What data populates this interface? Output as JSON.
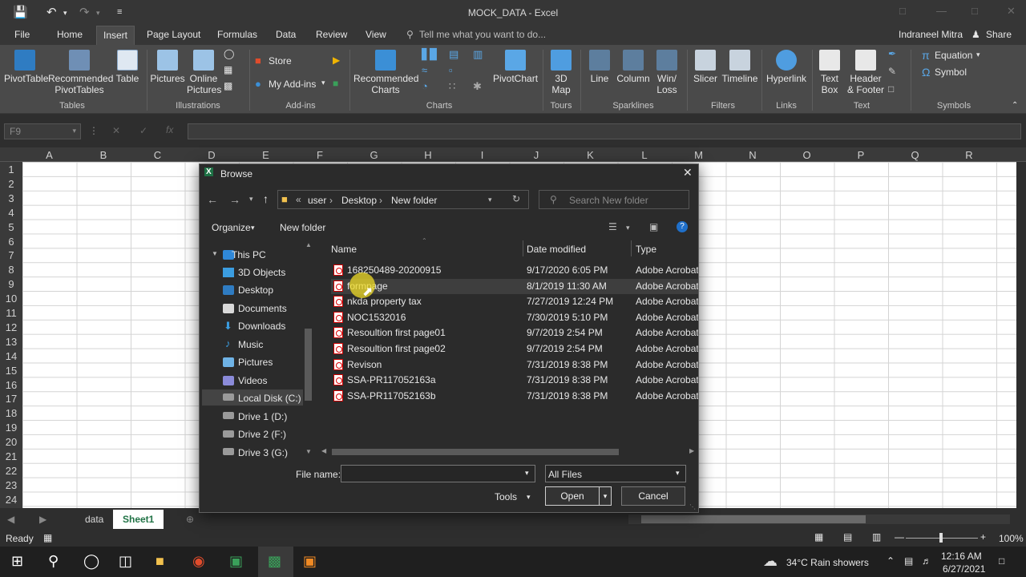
{
  "window": {
    "title": "MOCK_DATA - Excel"
  },
  "tabs": [
    "File",
    "Home",
    "Insert",
    "Page Layout",
    "Formulas",
    "Data",
    "Review",
    "View"
  ],
  "tell_me": "Tell me what you want to do...",
  "user": "Indraneel Mitra",
  "share": "Share",
  "ribbon": {
    "pivottable": "PivotTable",
    "recommended_pivottables": [
      "Recommended",
      "PivotTables"
    ],
    "table": "Table",
    "pictures": "Pictures",
    "online_pictures": [
      "Online",
      "Pictures"
    ],
    "store": "Store",
    "my_addins": "My Add-ins",
    "recommended_charts": [
      "Recommended",
      "Charts"
    ],
    "pivotchart": "PivotChart",
    "map3d": [
      "3D",
      "Map"
    ],
    "line": "Line",
    "column": "Column",
    "winloss": [
      "Win/",
      "Loss"
    ],
    "slicer": "Slicer",
    "timeline": "Timeline",
    "hyperlink": "Hyperlink",
    "textbox": [
      "Text",
      "Box"
    ],
    "header_footer": [
      "Header",
      "& Footer"
    ],
    "equation": "Equation",
    "symbol": "Symbol",
    "groups": [
      "Tables",
      "Illustrations",
      "Add-ins",
      "Charts",
      "Tours",
      "Sparklines",
      "Filters",
      "Links",
      "Text",
      "Symbols"
    ]
  },
  "namebox": "F9",
  "columns": [
    "A",
    "B",
    "C",
    "D",
    "E",
    "F",
    "G",
    "H",
    "I",
    "J",
    "K",
    "L",
    "M",
    "N",
    "O",
    "P",
    "Q",
    "R"
  ],
  "rows": [
    "1",
    "2",
    "3",
    "4",
    "5",
    "6",
    "7",
    "8",
    "9",
    "10",
    "11",
    "12",
    "13",
    "14",
    "15",
    "16",
    "17",
    "18",
    "19",
    "20",
    "21",
    "22",
    "23",
    "24"
  ],
  "sheets": [
    "data",
    "Sheet1"
  ],
  "status": {
    "ready": "Ready",
    "zoom": "100%"
  },
  "taskbar": {
    "weather": "34°C  Rain showers",
    "time": "12:16 AM",
    "date": "6/27/2021"
  },
  "dialog": {
    "title": "Browse",
    "breadcrumb": [
      "user",
      "Desktop",
      "New folder"
    ],
    "search_placeholder": "Search New folder",
    "organize": "Organize",
    "new_folder": "New folder",
    "nav": [
      "This PC",
      "3D Objects",
      "Desktop",
      "Documents",
      "Downloads",
      "Music",
      "Pictures",
      "Videos",
      "Local Disk (C:)",
      "Drive 1 (D:)",
      "Drive 2 (F:)",
      "Drive 3 (G:)"
    ],
    "headers": {
      "name": "Name",
      "date": "Date modified",
      "type": "Type"
    },
    "files": [
      {
        "name": "168250489-20200915",
        "date": "9/17/2020 6:05 PM",
        "type": "Adobe Acrobat D"
      },
      {
        "name": "formpage",
        "date": "8/1/2019 11:30 AM",
        "type": "Adobe Acrobat D"
      },
      {
        "name": "nkda property tax",
        "date": "7/27/2019 12:24 PM",
        "type": "Adobe Acrobat D"
      },
      {
        "name": "NOC1532016",
        "date": "7/30/2019 5:10 PM",
        "type": "Adobe Acrobat D"
      },
      {
        "name": "Resoultion first page01",
        "date": "9/7/2019 2:54 PM",
        "type": "Adobe Acrobat D"
      },
      {
        "name": "Resoultion first page02",
        "date": "9/7/2019 2:54 PM",
        "type": "Adobe Acrobat D"
      },
      {
        "name": "Revison",
        "date": "7/31/2019 8:38 PM",
        "type": "Adobe Acrobat D"
      },
      {
        "name": "SSA-PR117052163a",
        "date": "7/31/2019 8:38 PM",
        "type": "Adobe Acrobat D"
      },
      {
        "name": "SSA-PR117052163b",
        "date": "7/31/2019 8:38 PM",
        "type": "Adobe Acrobat D"
      }
    ],
    "filename_label": "File name:",
    "filename_value": "",
    "filetype": "All Files",
    "tools": "Tools",
    "open": "Open",
    "cancel": "Cancel"
  }
}
